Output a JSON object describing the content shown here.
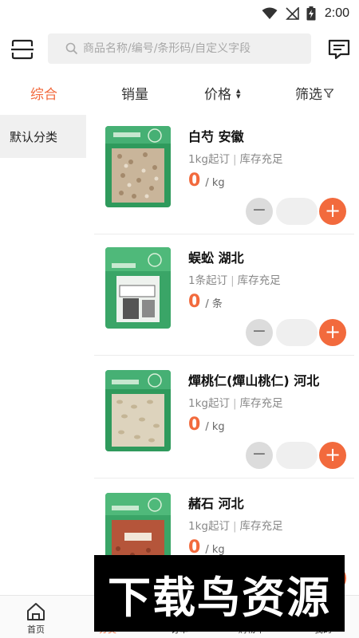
{
  "status_bar": {
    "time": "2:00"
  },
  "search": {
    "placeholder": "商品名称/编号/条形码/自定义字段"
  },
  "sort_tabs": [
    {
      "label": "综合",
      "active": true
    },
    {
      "label": "销量",
      "active": false
    },
    {
      "label": "价格",
      "active": false
    },
    {
      "label": "筛选",
      "active": false
    }
  ],
  "categories": [
    {
      "label": "默认分类",
      "active": true
    }
  ],
  "products": [
    {
      "name": "白芍 安徽",
      "min_order": "1kg起订",
      "stock": "库存充足",
      "price": "0",
      "unit": "/ kg",
      "qty": ""
    },
    {
      "name": "蜈蚣 湖北",
      "min_order": "1条起订",
      "stock": "库存充足",
      "price": "0",
      "unit": "/ 条",
      "qty": ""
    },
    {
      "name": "燀桃仁(燀山桃仁) 河北",
      "min_order": "1kg起订",
      "stock": "库存充足",
      "price": "0",
      "unit": "/ kg",
      "qty": ""
    },
    {
      "name": "赭石 河北",
      "min_order": "1kg起订",
      "stock": "库存充足",
      "price": "0",
      "unit": "/ kg",
      "qty": ""
    }
  ],
  "stepper": {
    "minus": "−",
    "plus": "+"
  },
  "bottom_nav": [
    {
      "label": "首页",
      "icon": "home-icon",
      "active": false
    },
    {
      "label": "分类",
      "icon": "category-icon",
      "active": true
    },
    {
      "label": "订单",
      "icon": "order-icon",
      "active": false
    },
    {
      "label": "购物车",
      "icon": "cart-icon",
      "active": false
    },
    {
      "label": "我的",
      "icon": "profile-icon",
      "active": false
    }
  ],
  "watermark": {
    "text": "下载鸟资源"
  },
  "colors": {
    "accent": "#f26a3d",
    "package_green": "#2f9a5c",
    "search_bg": "#f0f0f0"
  }
}
